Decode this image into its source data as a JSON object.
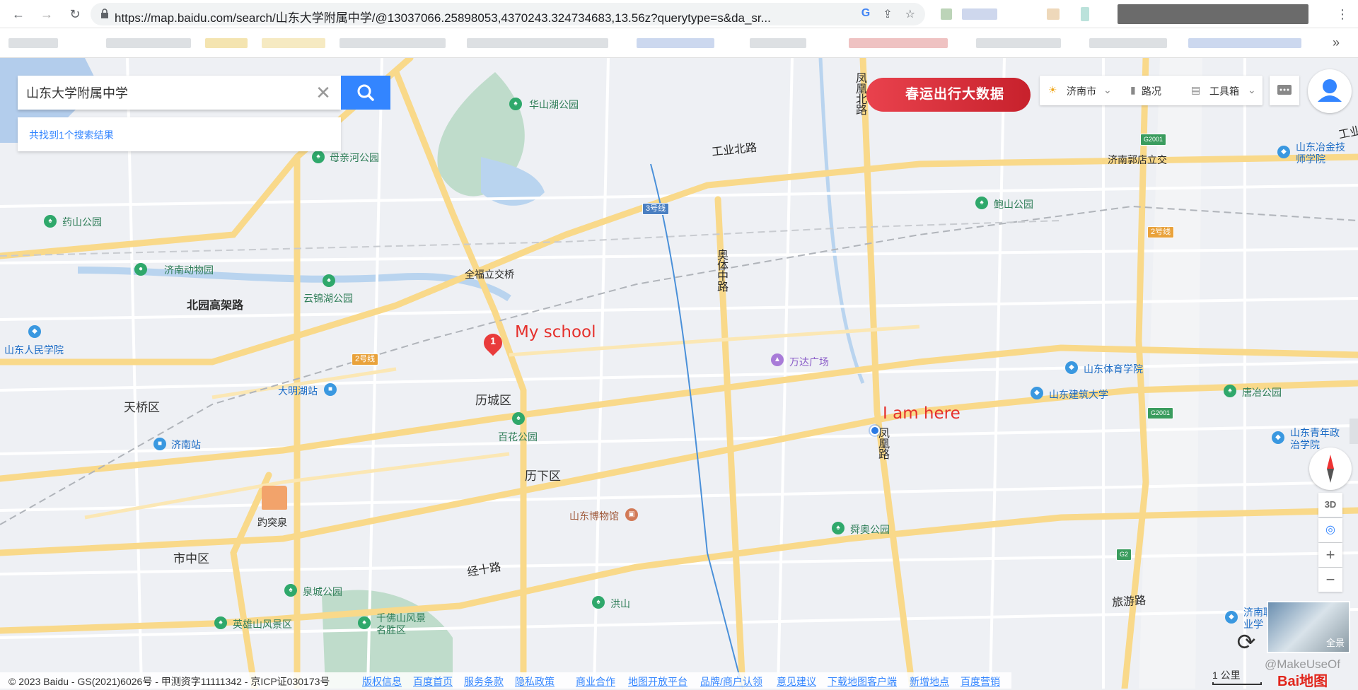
{
  "browser": {
    "url": "https://map.baidu.com/search/山东大学附属中学/@13037066.25898053,4370243.324734683,13.56z?querytype=s&da_sr...",
    "back_icon": "arrow-left-icon",
    "forward_icon": "arrow-right-icon",
    "reload_icon": "reload-icon",
    "more_glyph": "»"
  },
  "search": {
    "query": "山东大学附属中学",
    "clear_glyph": "✕",
    "result_text": "共找到1个搜索结果"
  },
  "toolbar": {
    "banner_text": "春运出行大数据",
    "city": "济南市",
    "traffic": "路况",
    "tools": "工具箱"
  },
  "annotations": {
    "school": "My school",
    "here": "I am here"
  },
  "markers": {
    "school_number": "1"
  },
  "map_labels": {
    "districts": [
      "天桥区",
      "历城区",
      "历下区",
      "市中区"
    ],
    "roads": {
      "gongye_bei": "工业北路",
      "beiyuan": "北园高架路",
      "jingshi": "经十路",
      "lvyou": "旅游路",
      "aoti": "奥体中路",
      "fenghuang_top": "凤凰北路",
      "fenghuang_mid": "凤凰路",
      "quanfuli": "全福立交桥",
      "jinan_guodian": "济南郭店立交",
      "gongye_edge": "工业"
    },
    "metro": [
      "3号线",
      "2号线",
      "2号线"
    ],
    "highways": [
      "G2001",
      "G2001",
      "G2"
    ],
    "pois": {
      "huashanhu": "华山湖公园",
      "muqinhe": "母亲河公园",
      "yaoshan": "药山公园",
      "dongwuyuan": "济南动物园",
      "yunjinhu": "云锦湖公园",
      "renmin": "山东人民学院",
      "daminghu": "大明湖站",
      "jinanzhan": "济南站",
      "baotuquan": "趵突泉",
      "baihua": "百花公园",
      "wanda": "万达广场",
      "bowuguan": "山东博物馆",
      "shunao": "舜奥公园",
      "quancheng": "泉城公园",
      "qianfoshan": "千佛山风景名胜区",
      "yingxiongshan": "英雄山风景区",
      "hongshan": "洪山",
      "baoshan": "鲍山公园",
      "tiyu": "山东体育学院",
      "jianzhu": "山东建筑大学",
      "tangye": "唐冶公园",
      "yejin": "山东冶金技师学院",
      "qingnian": "山东青年政治学院",
      "zhiye": "济南职业学"
    }
  },
  "controls": {
    "btn_3d": "3D",
    "zoom_in": "+",
    "zoom_out": "−",
    "pano_label": "全景",
    "refresh_glyph": "⟳"
  },
  "footer": {
    "copyright": "© 2023 Baidu - GS(2021)6026号 - 甲测资字11111342 - 京ICP证030173号",
    "links": [
      "版权信息",
      "百度首页",
      "服务条款",
      "隐私政策",
      "商业合作",
      "地图开放平台",
      "品牌/商户认领",
      "意见建议",
      "下载地图客户端",
      "新增地点",
      "百度营销"
    ],
    "scale": "1 公里",
    "logo": "Bai地图",
    "watermark": "@MakeUseOf"
  }
}
